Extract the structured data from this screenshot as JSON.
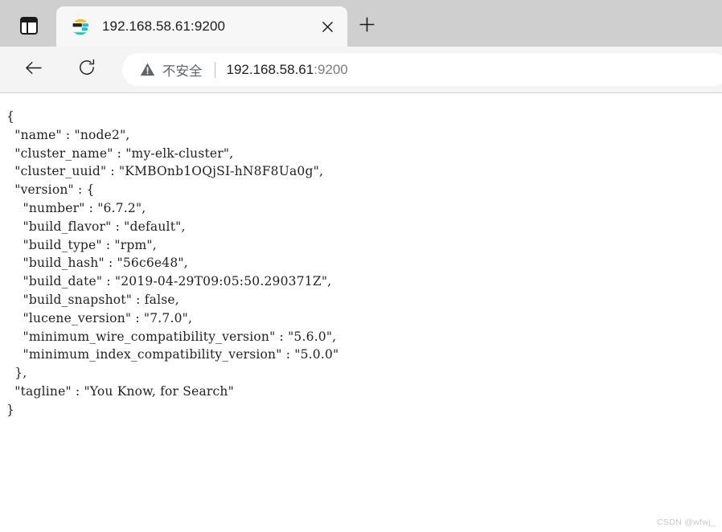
{
  "browser": {
    "tab_actions_icon": "tab-actions-icon",
    "tab": {
      "favicon": "elasticsearch-favicon",
      "title": "192.168.58.61:9200",
      "close_icon": "close-icon"
    },
    "new_tab_icon": "plus-icon",
    "toolbar": {
      "back_icon": "back-arrow-icon",
      "reload_icon": "reload-icon",
      "security_icon": "warning-triangle-icon",
      "security_label": "不安全",
      "url_host": "192.168.58.61",
      "url_port": ":9200"
    }
  },
  "page": {
    "json_text": "{\n  \"name\" : \"node2\",\n  \"cluster_name\" : \"my-elk-cluster\",\n  \"cluster_uuid\" : \"KMBOnb1OQjSI-hN8F8Ua0g\",\n  \"version\" : {\n    \"number\" : \"6.7.2\",\n    \"build_flavor\" : \"default\",\n    \"build_type\" : \"rpm\",\n    \"build_hash\" : \"56c6e48\",\n    \"build_date\" : \"2019-04-29T09:05:50.290371Z\",\n    \"build_snapshot\" : false,\n    \"lucene_version\" : \"7.7.0\",\n    \"minimum_wire_compatibility_version\" : \"5.6.0\",\n    \"minimum_index_compatibility_version\" : \"5.0.0\"\n  },\n  \"tagline\" : \"You Know, for Search\"\n}",
    "json_fields": {
      "name": "node2",
      "cluster_name": "my-elk-cluster",
      "cluster_uuid": "KMBOnb1OQjSI-hN8F8Ua0g",
      "version": {
        "number": "6.7.2",
        "build_flavor": "default",
        "build_type": "rpm",
        "build_hash": "56c6e48",
        "build_date": "2019-04-29T09:05:50.290371Z",
        "build_snapshot": "false",
        "lucene_version": "7.7.0",
        "minimum_wire_compatibility_version": "5.6.0",
        "minimum_index_compatibility_version": "5.0.0"
      },
      "tagline": "You Know, for Search"
    },
    "watermark": "CSDN @wfwj_"
  },
  "colors": {
    "tabstrip_bg": "#cfcfcf",
    "toolbar_bg": "#f4f4f4",
    "tab_bg": "#f7f7f7",
    "omnibox_bg": "#ffffff",
    "text": "#202124",
    "muted_text": "#5f6368",
    "favicon_yellow": "#f0bf1a",
    "favicon_blue": "#23bbe8",
    "favicon_teal": "#24c3ad",
    "favicon_dark": "#232323",
    "watermark": "#c8c8c8"
  }
}
